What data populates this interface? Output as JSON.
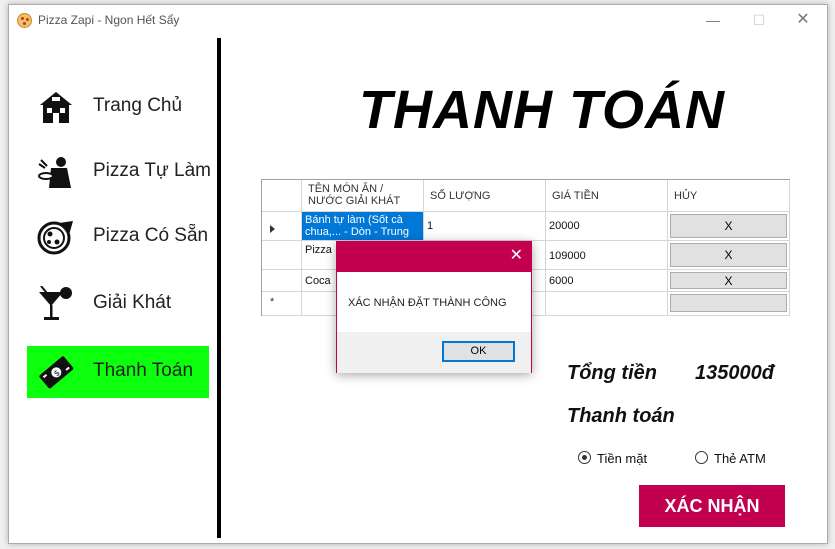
{
  "window": {
    "title": "Pizza Zapi - Ngon Hết Sẩy",
    "minimize": "—",
    "maximize": "☐",
    "close": "✕"
  },
  "sidebar": {
    "items": [
      {
        "label": "Trang Chủ",
        "icon": "house-icon"
      },
      {
        "label": "Pizza Tự Làm",
        "icon": "chef-icon"
      },
      {
        "label": "Pizza Có Sẵn",
        "icon": "pizza-icon"
      },
      {
        "label": "Giải Khát",
        "icon": "cocktail-icon"
      },
      {
        "label": "Thanh Toán",
        "icon": "cash-icon",
        "active": true
      }
    ],
    "active_color": "#0cff0c"
  },
  "page": {
    "title": "THANH TOÁN"
  },
  "grid": {
    "columns": [
      "TÊN MÓN ĂN / NƯỚC GIẢI KHÁT",
      "SỐ LƯỢNG",
      "GIÁ TIỀN",
      "HỦY"
    ],
    "rows": [
      {
        "name": "Bánh tự làm (Sốt cà chua,... - Dòn - Trung",
        "qty": "1",
        "price": "20000",
        "cancel": "X"
      },
      {
        "name": "Pizza ... Dòn",
        "qty": "",
        "price": "109000",
        "cancel": "X"
      },
      {
        "name": "Coca",
        "qty": "",
        "price": "6000",
        "cancel": "X"
      }
    ],
    "new_row_marker": "*"
  },
  "summary": {
    "total_label": "Tổng tiền",
    "total_value": "135000đ",
    "payment_label": "Thanh toán",
    "options": [
      {
        "label": "Tiền mặt",
        "selected": true
      },
      {
        "label": "Thẻ ATM",
        "selected": false
      }
    ],
    "confirm_label": "XÁC NHẬN",
    "confirm_color": "#c2004f"
  },
  "dialog": {
    "message": "XÁC NHẬN ĐẶT THÀNH CÔNG",
    "ok_label": "OK",
    "close": "✕",
    "accent": "#c2004f"
  }
}
